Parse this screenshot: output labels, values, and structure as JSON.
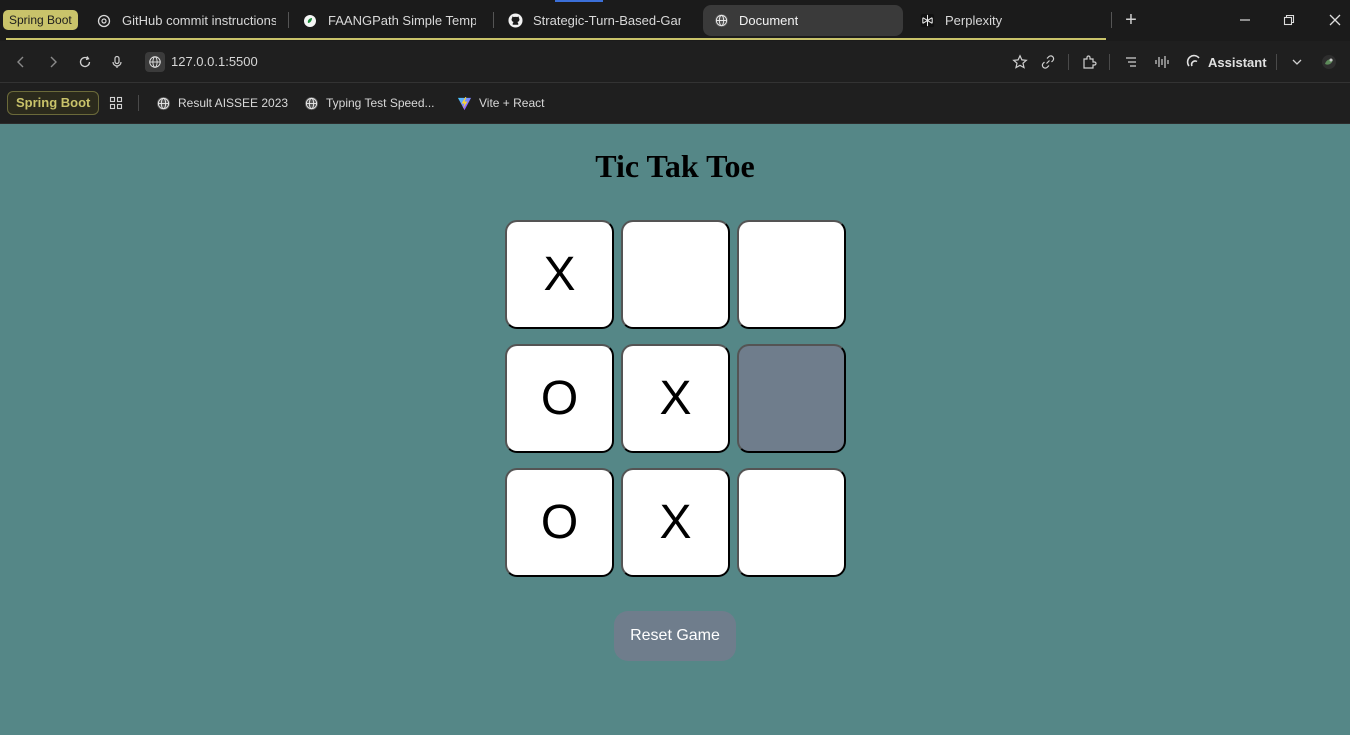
{
  "tabs": {
    "group_label": "Spring Boot",
    "items": [
      {
        "label": "GitHub commit instructions",
        "icon": "chatgpt-icon"
      },
      {
        "label": "FAANGPath Simple Template (",
        "icon": "overleaf-icon"
      },
      {
        "label": "Strategic-Turn-Based-Game-E",
        "icon": "github-icon"
      },
      {
        "label": "Document",
        "icon": "globe-icon"
      },
      {
        "label": "Perplexity",
        "icon": "perplexity-icon"
      }
    ],
    "new_tab": "+"
  },
  "address_bar": {
    "url": "127.0.0.1:5500",
    "assistant_label": "Assistant"
  },
  "bookmarks": {
    "group_label": "Spring Boot",
    "items": [
      {
        "label": "Result AISSEE 2023",
        "icon": "globe-icon"
      },
      {
        "label": "Typing Test Speed...",
        "icon": "globe-icon"
      },
      {
        "label": "Vite + React",
        "icon": "vite-icon"
      }
    ]
  },
  "game": {
    "title": "Tic Tak Toe",
    "cells": [
      "X",
      "",
      "",
      "O",
      "X",
      "",
      "O",
      "X",
      ""
    ],
    "reset_label": "Reset Game"
  },
  "colors": {
    "page_background": "#558787",
    "cell": "#ffffff",
    "cell_hover": "#6f7d8c",
    "button": "#6f7d8c",
    "group_accent": "#c9c36a"
  }
}
